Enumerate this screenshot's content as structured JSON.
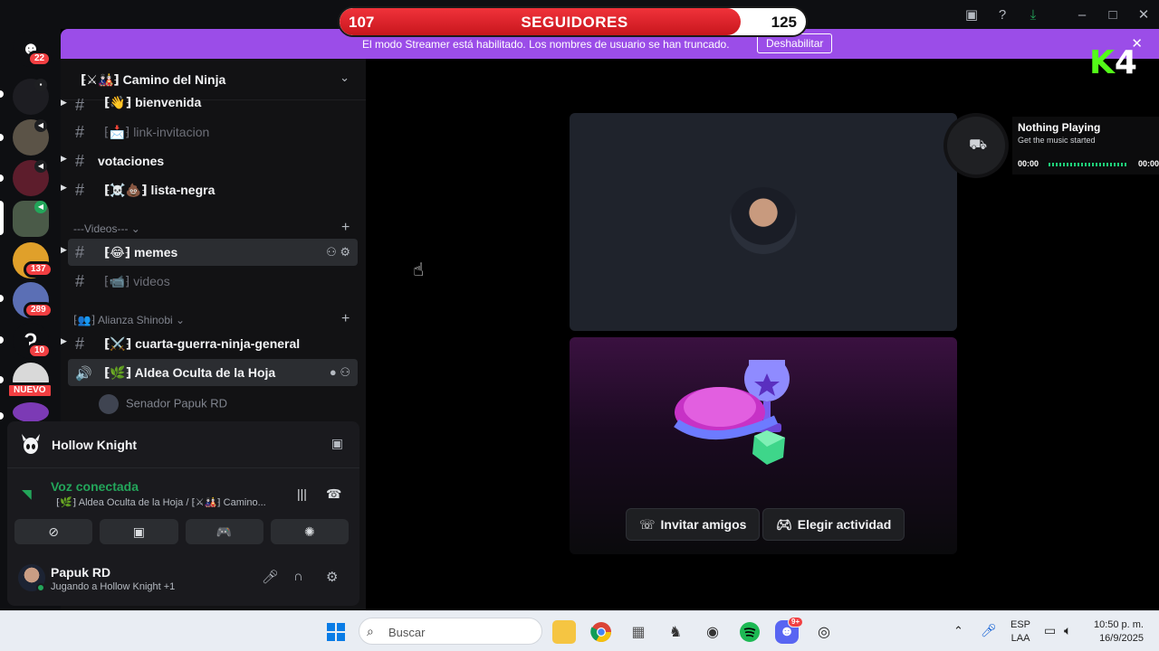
{
  "follower_goal": {
    "current": "107",
    "label": "SEGUIDORES",
    "goal": "125",
    "progress_fraction": 0.86
  },
  "banner": {
    "text": "El modo Streamer está habilitado. Los nombres de usuario se han truncado.",
    "button": "Deshabilitar"
  },
  "server_rail": {
    "badges": [
      "22",
      "137",
      "289",
      "10"
    ],
    "new_label": "NUEVO"
  },
  "server": {
    "name": "⁅⚔🎎⁆ Camino del Ninja"
  },
  "channels": [
    {
      "name": "⁅👋⁆ bienvenida",
      "style": "bright"
    },
    {
      "name": "⁅📩⁆ link-invitacion",
      "style": "muted"
    },
    {
      "name": "votaciones",
      "style": "bright"
    },
    {
      "name": "⁅☠️💩⁆ lista-negra",
      "style": "bright"
    },
    {
      "name": "⁅😂⁆ memes",
      "style": "bright"
    },
    {
      "name": "⁅📹⁆ videos",
      "style": "muted"
    },
    {
      "name": "⁅⚔️⁆ cuarta-guerra-ninja-general",
      "style": "bright"
    },
    {
      "name": "⁅🌿⁆ Aldea Oculta de la Hoja",
      "style": "bright"
    }
  ],
  "categories": {
    "videos": "---Videos---",
    "alianza": "⁅👥⁆ Alianza Shinobi"
  },
  "voice_member": "Senador Papuk RD",
  "activity": {
    "game": "Hollow Knight"
  },
  "voice_connection": {
    "state": "Voz conectada",
    "where": "⁅🌿⁆ Aldea Oculta de la Hoja / ⁅⚔🎎⁆ Camino..."
  },
  "user": {
    "name": "Papuk RD",
    "status": "Jugando a Hollow Knight +1"
  },
  "stage": {
    "invite_label": "Invitar amigos",
    "activity_label": "Elegir actividad"
  },
  "now_playing": {
    "title": "Nothing Playing",
    "subtitle": "Get the music started",
    "time_start": "00:00",
    "time_end": "00:00"
  },
  "kick_overlay": {
    "number": "4"
  },
  "taskbar": {
    "search_placeholder": "Buscar",
    "lang_1": "ESP",
    "lang_2": "LAA",
    "time": "10:50 p. m.",
    "date": "16/9/2025",
    "discord_badge": "9+"
  }
}
